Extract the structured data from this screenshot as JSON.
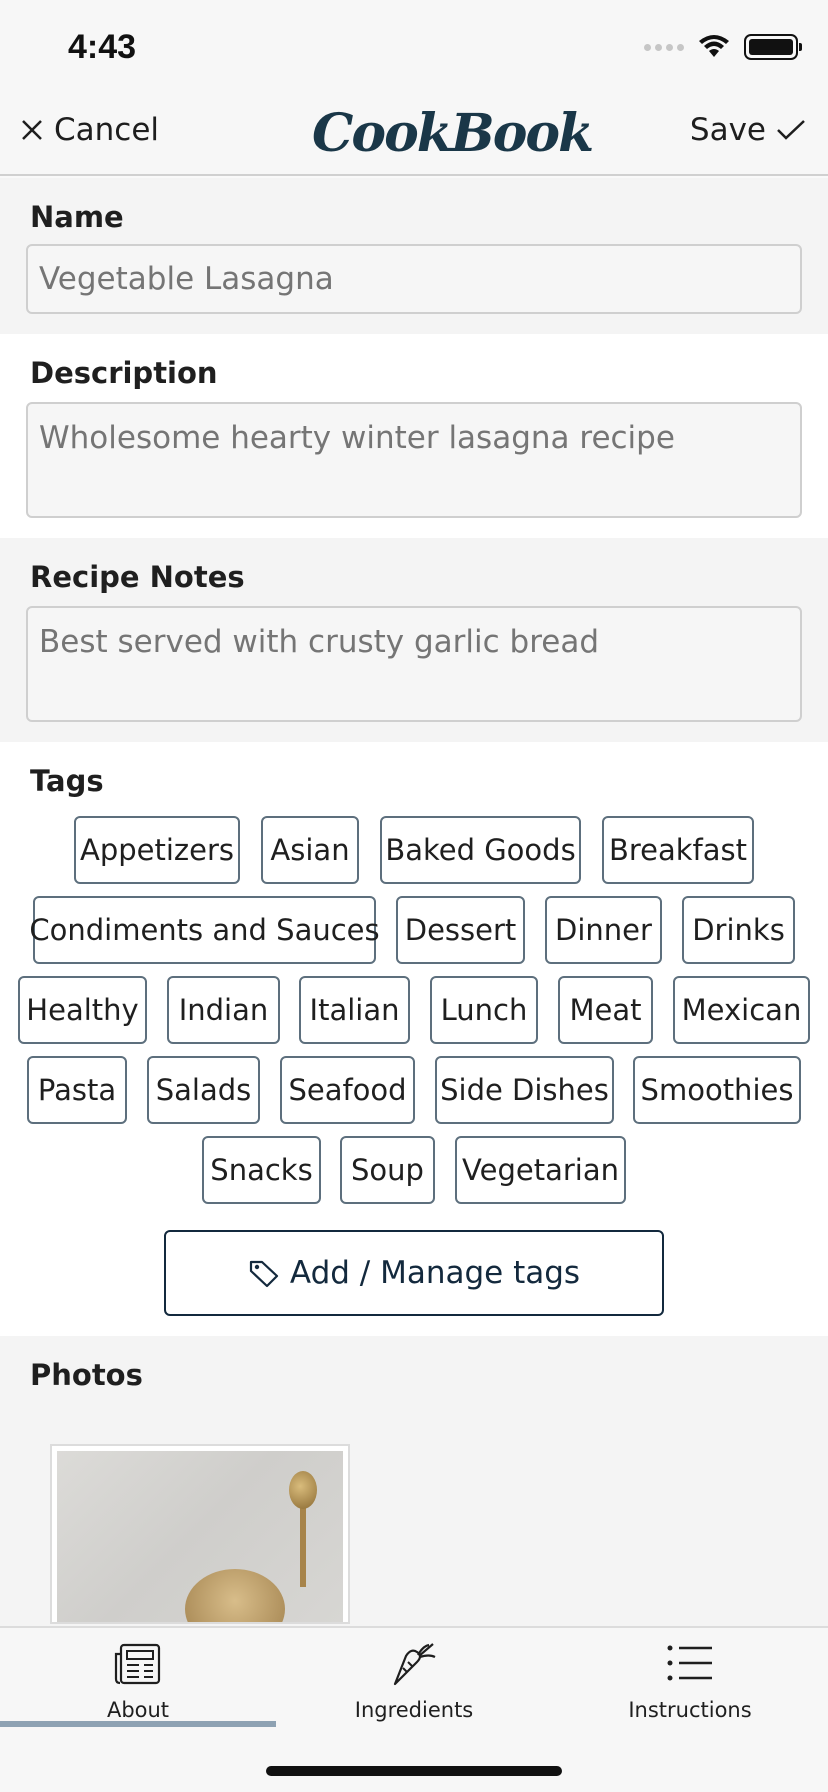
{
  "status": {
    "time": "4:43"
  },
  "nav": {
    "cancel_label": "Cancel",
    "title": "CookBook",
    "save_label": "Save"
  },
  "form": {
    "name": {
      "label": "Name",
      "placeholder": "Vegetable Lasagna"
    },
    "description": {
      "label": "Description",
      "placeholder": "Wholesome hearty winter lasagna recipe"
    },
    "notes": {
      "label": "Recipe Notes",
      "placeholder": "Best served with crusty garlic bread"
    }
  },
  "tags": {
    "label": "Tags",
    "items": [
      "Appetizers",
      "Asian",
      "Baked Goods",
      "Breakfast",
      "Condiments and Sauces",
      "Dessert",
      "Dinner",
      "Drinks",
      "Healthy",
      "Indian",
      "Italian",
      "Lunch",
      "Meat",
      "Mexican",
      "Pasta",
      "Salads",
      "Seafood",
      "Side Dishes",
      "Smoothies",
      "Snacks",
      "Soup",
      "Vegetarian"
    ],
    "manage_label": "Add / Manage tags"
  },
  "photos": {
    "label": "Photos"
  },
  "tabs": [
    {
      "label": "About",
      "icon": "newspaper-icon",
      "active": true
    },
    {
      "label": "Ingredients",
      "icon": "carrot-icon",
      "active": false
    },
    {
      "label": "Instructions",
      "icon": "list-icon",
      "active": false
    }
  ],
  "colors": {
    "accent": "#13293d",
    "tag_border": "#5d6f7d",
    "tab_indicator": "#8ea2b3",
    "logo": "#1a3748"
  }
}
